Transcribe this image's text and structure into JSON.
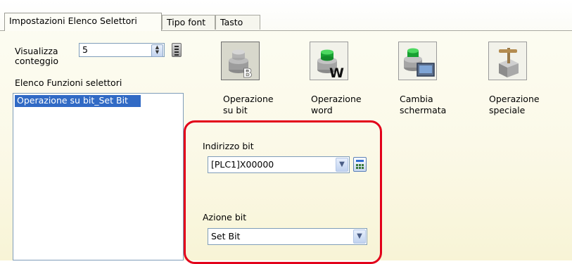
{
  "tabs": [
    {
      "label": "Impostazioni Elenco Selettori"
    },
    {
      "label": "Tipo font"
    },
    {
      "label": "Tasto"
    }
  ],
  "count": {
    "label_line1": "Visualizza",
    "label_line2": "conteggio",
    "value": "5"
  },
  "list": {
    "title": "Elenco Funzioni selettori",
    "items": [
      "Operazione su bit_Set Bit"
    ]
  },
  "functions": [
    {
      "line1": "Operazione",
      "line2": "su bit",
      "icon": "bit-operation-icon",
      "selected": true
    },
    {
      "line1": "Operazione",
      "line2": "word",
      "icon": "word-operation-icon",
      "selected": false
    },
    {
      "line1": "Cambia",
      "line2": "schermata",
      "icon": "change-screen-icon",
      "selected": false
    },
    {
      "line1": "Operazione",
      "line2": "speciale",
      "icon": "special-operation-icon",
      "selected": false
    }
  ],
  "bit_address": {
    "label": "Indirizzo bit",
    "value": "[PLC1]X00000"
  },
  "bit_action": {
    "label": "Azione bit",
    "value": "Set Bit"
  },
  "colors": {
    "highlight": "#e2001a",
    "selection": "#316ac5",
    "green_cap": "#22b53a"
  }
}
